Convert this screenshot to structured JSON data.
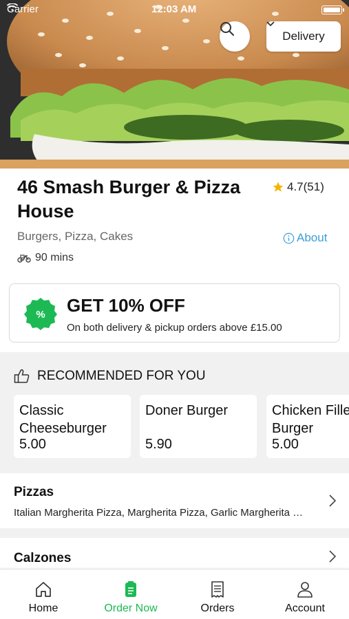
{
  "status_bar": {
    "carrier": "Carrier",
    "time": "12:03 AM"
  },
  "header": {
    "delivery_mode": "Delivery",
    "search_icon": "search-icon"
  },
  "restaurant": {
    "name": "46 Smash Burger & Pizza House",
    "rating": "4.7(51)",
    "cuisines": "Burgers, Pizza, Cakes",
    "about_label": "About",
    "delivery_time": "90 mins"
  },
  "offer": {
    "title": "GET 10% OFF",
    "subtitle": "On both delivery & pickup orders above £15.00",
    "badge_color": "#1db954"
  },
  "recommended": {
    "heading": "RECOMMENDED FOR YOU",
    "items": [
      {
        "name": "Classic Cheeseburger",
        "price": "5.00"
      },
      {
        "name": "Doner Burger",
        "price": "5.90"
      },
      {
        "name": "Chicken Fillet Burger",
        "price": "5.00"
      }
    ]
  },
  "categories": [
    {
      "title": "Pizzas",
      "description": "Italian Margherita Pizza, Margherita Pizza, Garlic Margherita Pizza"
    },
    {
      "title": "Calzones",
      "description": ""
    }
  ],
  "tabbar": {
    "items": [
      {
        "label": "Home",
        "icon": "home-icon"
      },
      {
        "label": "Order Now",
        "icon": "order-icon",
        "active": true
      },
      {
        "label": "Orders",
        "icon": "receipt-icon"
      },
      {
        "label": "Account",
        "icon": "account-icon"
      }
    ],
    "accent": "#1db954"
  }
}
